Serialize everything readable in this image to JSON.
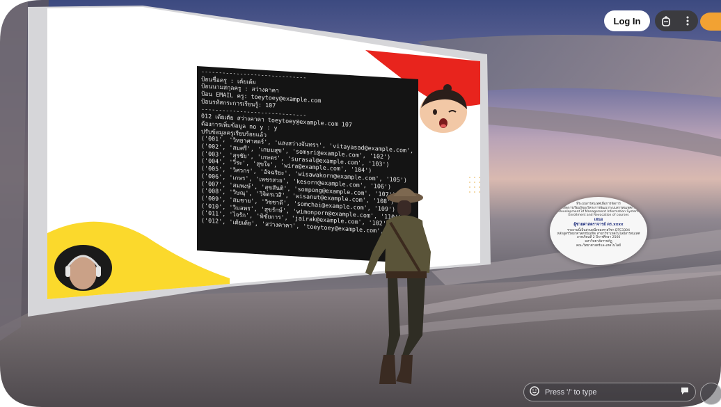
{
  "header": {
    "login_label": "Log In",
    "icons": [
      "backpack-icon",
      "more-vertical-icon"
    ]
  },
  "presentation": {
    "terminal_lines": [
      "------------------------------",
      "ป้อนชื่อครู : เต้ยเต้ย",
      "ป้อนนามสกุลครู : สว่างคาคา",
      "ป้อน EMAIL ครู: toeytoey@example.com",
      "ป้อนรหัสกระการเรียนรู้: 107",
      "------------------------------",
      "012 เต้ยเต้ย สว่างคาคา toeytoey@example.com 107",
      "ต้องการเพิ่มข้อมูล no y : y",
      "ปรับข้อมูลครูเรียบร้อยแล้ว",
      "('001', 'วิทยาศาสตร์', 'แสงสว่างจันทรา', 'vitayasad@example.com', '101')",
      "('002', 'สมศรี', 'เกษมสุข', 'somsri@example.com', '102')",
      "('003', 'สุรชัย', 'เกษตร', 'surasal@example.com', '103')",
      "('004', 'วีระ', 'สุขใจ', 'wira@example.com', '104')",
      "('005', 'วิศวกร', 'อัจฉริยะ', 'wisawakorn@example.com', '105')",
      "('006', 'เกษร', 'เพชรสวย', 'kesorn@example.com', '106')",
      "('007', 'สมพงษ์', 'สุขสันติ', 'sompong@example.com', '107')",
      "('008', 'วิษณุ', 'วิจิตรเวสิ', 'wisanut@example.com', '108')",
      "('009', 'สมชาย', 'วิชชาดี', 'somchai@example.com', '109')",
      "('010', 'วิมลพร', 'สุขรักษ์', 'wimonporn@example.com', '110')",
      "('011', 'ไจรัก', 'พิชัยการ', 'jairak@example.com', '102')",
      "('012', 'เต้ยเต้ย', 'สว่างคาคา', 'toeytoey@example.com', '107')"
    ]
  },
  "board": {
    "lines": [
      "ที่ระบบสารสนเทศเพื่อการจัดการ",
      "ระบบการจัดการเรียนรู้ของโครงการพัฒนาระบบสารสนเทศการจัดการ",
      "Development of Management Information System",
      "Enrollment and Revocation of courses",
      "เสนอ",
      "ผู้ช่วยศาสตราจารย์ ดร.xxxx",
      "รายงานนี้เป็นส่วนหนึ่งของรายวิชา DTC3304",
      "หลักสูตรวิทยาศาสตรบัณฑิต สาขาวิชาเทคโนโลยีสารสนเทศ",
      "ภาคเรียนที่ 2 ปีการศึกษา 2566",
      "มหาวิทยาลัยราชภัฏ",
      "คณะวิทยาศาสตร์และเทคโนโลยี"
    ]
  },
  "chat": {
    "placeholder": "Press '/' to type"
  },
  "colors": {
    "accent_red": "#e8241d",
    "accent_yellow": "#fbd92c",
    "orange": "#f2a233"
  }
}
